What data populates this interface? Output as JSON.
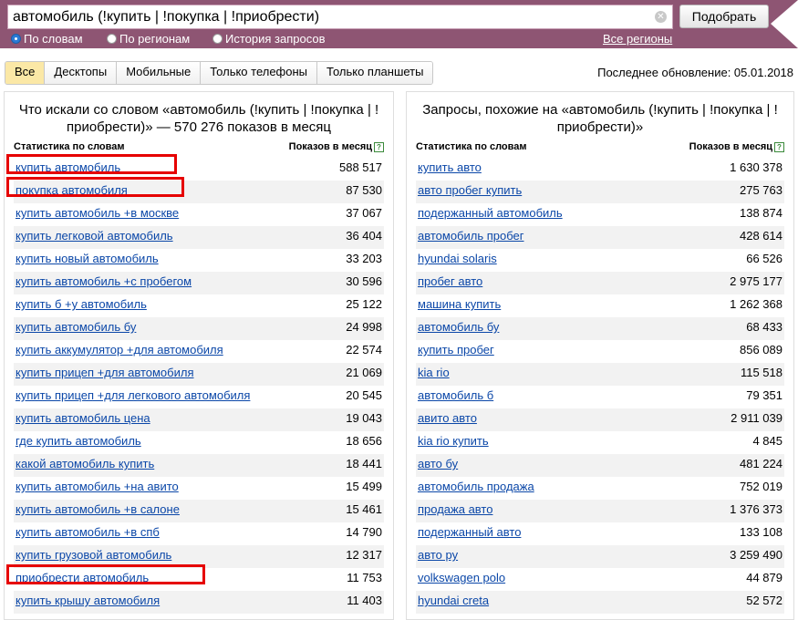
{
  "search": {
    "query": "автомобиль (!купить | !покупка | !приобрести)",
    "button": "Подобрать"
  },
  "modes": [
    {
      "label": "По словам",
      "selected": true
    },
    {
      "label": "По регионам",
      "selected": false
    },
    {
      "label": "История запросов",
      "selected": false
    }
  ],
  "regions_link": "Все регионы",
  "tabs": [
    {
      "label": "Все",
      "active": true
    },
    {
      "label": "Десктопы",
      "active": false
    },
    {
      "label": "Мобильные",
      "active": false
    },
    {
      "label": "Только телефоны",
      "active": false
    },
    {
      "label": "Только планшеты",
      "active": false
    }
  ],
  "last_update": "Последнее обновление: 05.01.2018",
  "left_panel": {
    "title": "Что искали со словом «автомобиль (!купить | !покупка | !приобрести)» — 570 276 показов в месяц",
    "col_keyword": "Статистика по словам",
    "col_count": "Показов в месяц",
    "help_icon": "?",
    "rows": [
      {
        "k": "купить автомобиль",
        "v": "588 517",
        "highlight": true
      },
      {
        "k": "покупка автомобиля",
        "v": "87 530",
        "highlight": true
      },
      {
        "k": "купить автомобиль +в москве",
        "v": "37 067"
      },
      {
        "k": "купить легковой автомобиль",
        "v": "36 404"
      },
      {
        "k": "купить новый автомобиль",
        "v": "33 203"
      },
      {
        "k": "купить автомобиль +с пробегом",
        "v": "30 596"
      },
      {
        "k": "купить б +у автомобиль",
        "v": "25 122"
      },
      {
        "k": "купить автомобиль бу",
        "v": "24 998"
      },
      {
        "k": "купить аккумулятор +для автомобиля",
        "v": "22 574"
      },
      {
        "k": "купить прицеп +для автомобиля",
        "v": "21 069"
      },
      {
        "k": "купить прицеп +для легкового автомобиля",
        "v": "20 545"
      },
      {
        "k": "купить автомобиль цена",
        "v": "19 043"
      },
      {
        "k": "где купить автомобиль",
        "v": "18 656"
      },
      {
        "k": "какой автомобиль купить",
        "v": "18 441"
      },
      {
        "k": "купить автомобиль +на авито",
        "v": "15 499"
      },
      {
        "k": "купить автомобиль +в салоне",
        "v": "15 461"
      },
      {
        "k": "купить автомобиль +в спб",
        "v": "14 790"
      },
      {
        "k": "купить грузовой автомобиль",
        "v": "12 317"
      },
      {
        "k": "приобрести автомобиль",
        "v": "11 753",
        "highlight": true
      },
      {
        "k": "купить крышу автомобиля",
        "v": "11 403"
      }
    ]
  },
  "right_panel": {
    "title": "Запросы, похожие на «автомобиль (!купить | !покупка | !приобрести)»",
    "col_keyword": "Статистика по словам",
    "col_count": "Показов в месяц",
    "help_icon": "?",
    "rows": [
      {
        "k": "купить авто",
        "v": "1 630 378"
      },
      {
        "k": "авто пробег купить",
        "v": "275 763"
      },
      {
        "k": "подержанный автомобиль",
        "v": "138 874"
      },
      {
        "k": "автомобиль пробег",
        "v": "428 614"
      },
      {
        "k": "hyundai solaris",
        "v": "66 526"
      },
      {
        "k": "пробег авто",
        "v": "2 975 177"
      },
      {
        "k": "машина купить",
        "v": "1 262 368"
      },
      {
        "k": "автомобиль бу",
        "v": "68 433"
      },
      {
        "k": "купить пробег",
        "v": "856 089"
      },
      {
        "k": "kia rio",
        "v": "115 518"
      },
      {
        "k": "автомобиль б",
        "v": "79 351"
      },
      {
        "k": "авито авто",
        "v": "2 911 039"
      },
      {
        "k": "kia rio купить",
        "v": "4 845"
      },
      {
        "k": "авто бу",
        "v": "481 224"
      },
      {
        "k": "автомобиль продажа",
        "v": "752 019"
      },
      {
        "k": "продажа авто",
        "v": "1 376 373"
      },
      {
        "k": "подержанный авто",
        "v": "133 108"
      },
      {
        "k": "авто ру",
        "v": "3 259 490"
      },
      {
        "k": "volkswagen polo",
        "v": "44 879"
      },
      {
        "k": "hyundai creta",
        "v": "52 572"
      }
    ]
  }
}
